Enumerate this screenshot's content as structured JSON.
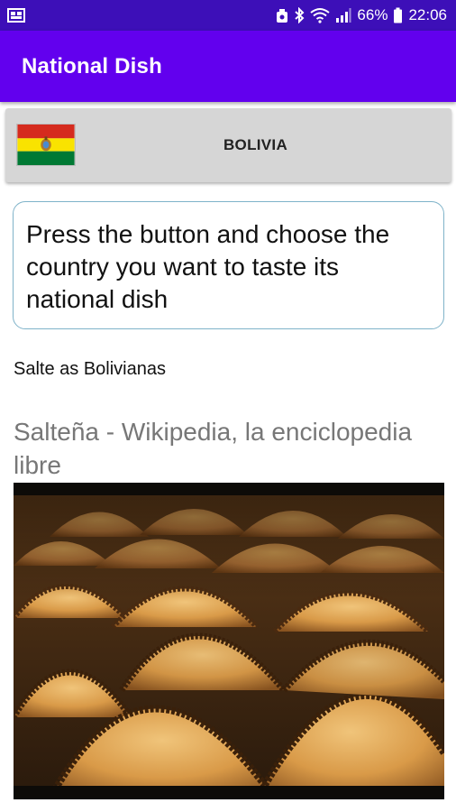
{
  "status_bar": {
    "battery_percent": "66%",
    "time": "22:06",
    "icons": [
      "gallery-icon",
      "alarm-icon",
      "bluetooth-icon",
      "wifi-icon",
      "signal-icon",
      "battery-icon"
    ]
  },
  "app_bar": {
    "title": "National Dish"
  },
  "country_selector": {
    "country": "BOLIVIA",
    "flag_colors": [
      "#d52b1e",
      "#f9e300",
      "#007934"
    ]
  },
  "instruction": {
    "text": "Press the button and choose the country you want to taste its national dish"
  },
  "result": {
    "dish_name": "Salte as Bolivianas",
    "source_title": "Salteña - Wikipedia, la enciclopedia libre",
    "image_subject": "saltenas"
  },
  "colors": {
    "status_bar": "#3d0fb8",
    "app_bar": "#6200ee",
    "button_bg": "#d6d6d6",
    "input_border": "#7fb3c9"
  }
}
